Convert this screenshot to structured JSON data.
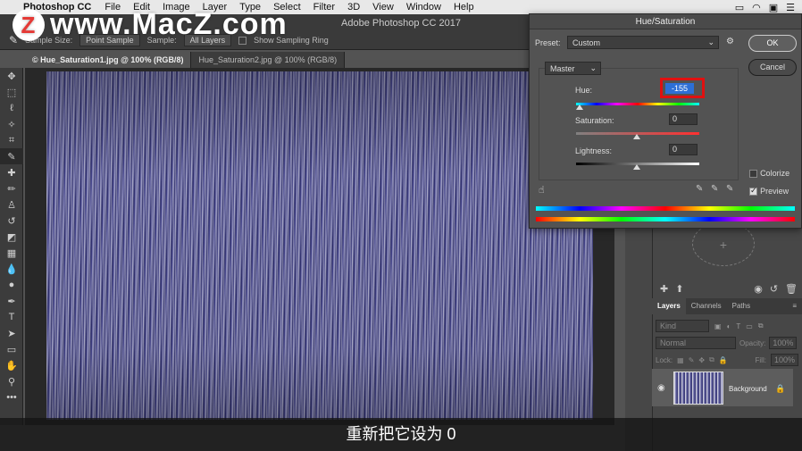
{
  "menubar": {
    "app": "Photoshop CC",
    "items": [
      "File",
      "Edit",
      "Image",
      "Layer",
      "Type",
      "Select",
      "Filter",
      "3D",
      "View",
      "Window",
      "Help"
    ]
  },
  "window_title": "Adobe Photoshop CC 2017",
  "watermark": {
    "logo": "Z",
    "text": "www.MacZ.com"
  },
  "options": {
    "sample_size_label": "Sample Size:",
    "sample_size_value": "Point Sample",
    "sample_label": "Sample:",
    "sample_value": "All Layers",
    "show_ring": "Show Sampling Ring"
  },
  "tabs": [
    {
      "label": "© Hue_Saturation1.jpg @ 100% (RGB/8)",
      "active": true
    },
    {
      "label": "Hue_Saturation2.jpg @ 100% (RGB/8)",
      "active": false
    }
  ],
  "dialog": {
    "title": "Hue/Saturation",
    "preset_label": "Preset:",
    "preset_value": "Custom",
    "ok_label": "OK",
    "cancel_label": "Cancel",
    "channel_value": "Master",
    "hue_label": "Hue:",
    "hue_value": "-155",
    "saturation_label": "Saturation:",
    "saturation_value": "0",
    "lightness_label": "Lightness:",
    "lightness_value": "0",
    "colorize_label": "Colorize",
    "preview_label": "Preview",
    "colorize_checked": false,
    "preview_checked": true
  },
  "layers_panel": {
    "tabs": [
      "Layers",
      "Channels",
      "Paths"
    ],
    "kind_label": "Kind",
    "blend_mode": "Normal",
    "opacity_label": "Opacity:",
    "opacity_value": "100%",
    "lock_label": "Lock:",
    "fill_label": "Fill:",
    "fill_value": "100%",
    "layer_name": "Background"
  },
  "subtitle": "重新把它设为 0",
  "colors": {
    "highlight_red": "#e01010",
    "selection_blue": "#2d6fd6"
  }
}
